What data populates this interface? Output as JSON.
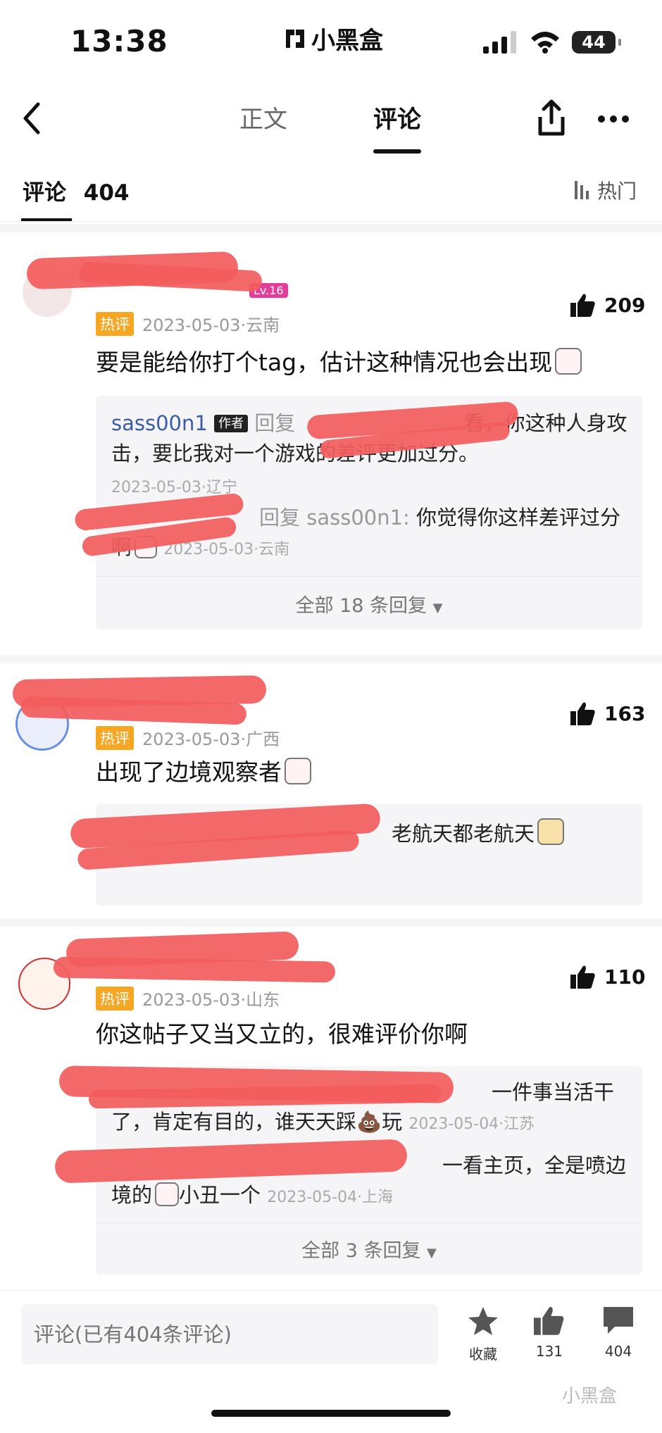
{
  "status": {
    "time": "13:38",
    "app_name": "小黑盒",
    "battery": "44"
  },
  "nav": {
    "tab_article": "正文",
    "tab_comments": "评论"
  },
  "comments_header": {
    "title": "评论",
    "count": "404",
    "sort_label": "热门"
  },
  "comments": [
    {
      "level_badge": "Lv.16",
      "hot_label": "热评",
      "meta": "2023-05-03·云南",
      "likes": "209",
      "text": "要是能给你打个tag，估计这种情况也会出现",
      "replies": [
        {
          "name": "sass00n1",
          "author_tag": "作者",
          "text_prefix": "回复",
          "text_tail": "看，你这种人身攻击，要比我对一个游戏的差评更加过分。",
          "meta": "2023-05-03·辽宁"
        },
        {
          "reply_to": "回复 sass00n1:",
          "text": "你觉得你这样差评过分啊",
          "meta": "2023-05-03·云南"
        }
      ],
      "more_replies": "全部 18 条回复"
    },
    {
      "hot_label": "热评",
      "meta": "2023-05-03·广西",
      "likes": "163",
      "text": "出现了边境观察者",
      "replies": [
        {
          "text": "老航天都老航天"
        }
      ]
    },
    {
      "hot_label": "热评",
      "meta": "2023-05-03·山东",
      "likes": "110",
      "text": "你这帖子又当又立的，很难评价你啊",
      "replies": [
        {
          "text_line1": "一件事当活干",
          "text_line2": "了，肯定有目的，谁天天踩💩玩",
          "meta": "2023-05-04·江苏"
        },
        {
          "text_line1": "一看主页，全是喷边",
          "text_line2": "境的",
          "text_line2b": "小丑一个",
          "meta": "2023-05-04·上海"
        }
      ],
      "more_replies": "全部 3 条回复"
    }
  ],
  "bottom_bar": {
    "input_placeholder": "评论(已有404条评论)",
    "favorite_label": "收藏",
    "like_count": "131",
    "comment_count": "404"
  },
  "watermark": "小黑盒",
  "colors": {
    "redaction": "#f25c5c",
    "hot_badge": "#f5a623",
    "link_name": "#3b5ca8"
  }
}
